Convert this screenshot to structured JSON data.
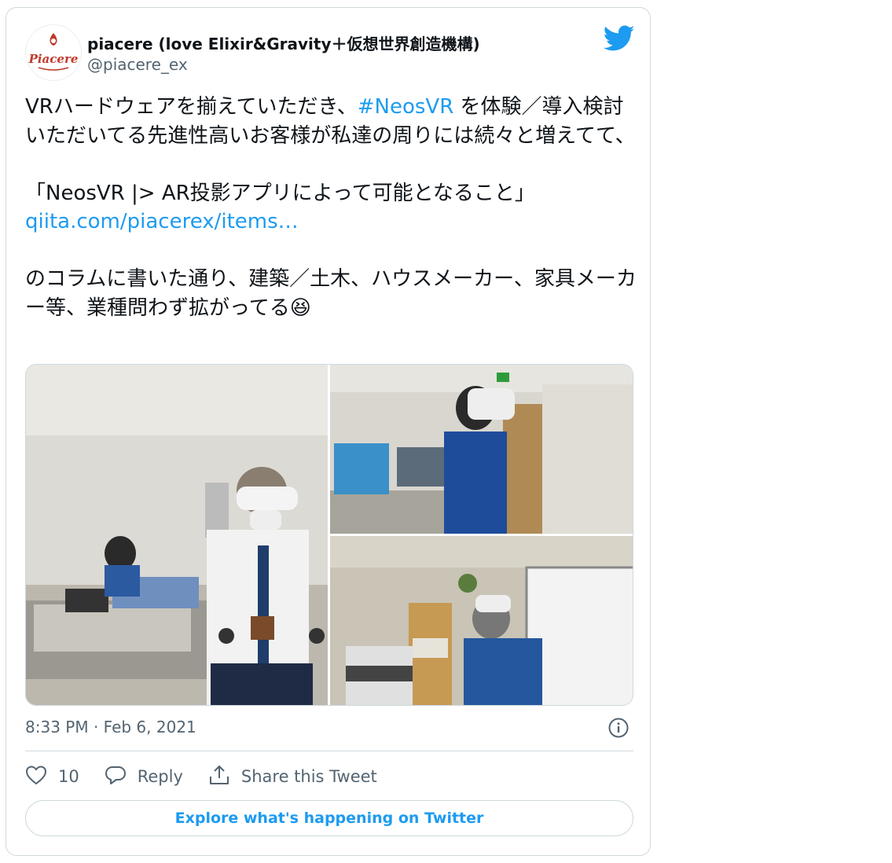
{
  "author": {
    "name": "piacere (love Elixir&Gravity＋仮想世界創造機構)",
    "handle": "@piacere_ex",
    "avatar_text": "Piacere"
  },
  "tweet": {
    "text_1": "VRハードウェアを揃えていただき、",
    "hashtag": "#NeosVR",
    "text_2": " を体験／導入検討いただいてる先進性高いお客様が私達の周りには続々と増えてて、\n\n「NeosVR |> AR投影アプリによって可能となること」\n",
    "link": "qiita.com/piacerex/items…",
    "text_3": "\n\nのコラムに書いた通り、建築／土木、ハウスメーカー、家具メーカー等、業種問わず拡がってる😆"
  },
  "media": {
    "photos": [
      "photo-office-left",
      "photo-office-top-right",
      "photo-office-bottom-right"
    ]
  },
  "timestamp": "8:33 PM · Feb 6, 2021",
  "actions": {
    "like_count": "10",
    "reply_label": "Reply",
    "share_label": "Share this Tweet"
  },
  "explore_label": "Explore what's happening on Twitter",
  "colors": {
    "accent": "#1d9bf0",
    "muted": "#536471",
    "border": "#cfd9de"
  },
  "icons": [
    "twitter-bird-icon",
    "info-icon",
    "heart-icon",
    "reply-icon",
    "share-icon"
  ]
}
